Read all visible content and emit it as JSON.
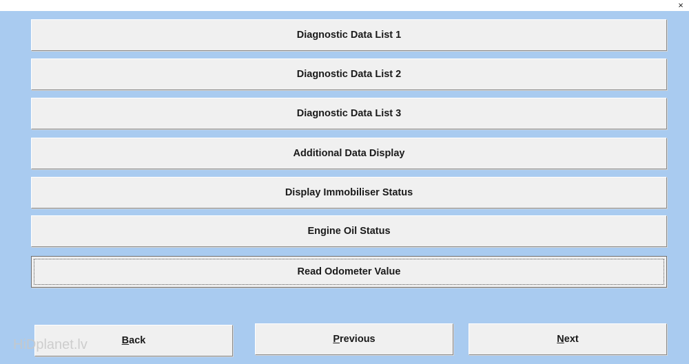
{
  "window": {
    "close_glyph": "×"
  },
  "menu": {
    "items": [
      {
        "label": "Diagnostic Data List 1"
      },
      {
        "label": "Diagnostic Data List 2"
      },
      {
        "label": "Diagnostic Data List 3"
      },
      {
        "label": "Additional Data Display"
      },
      {
        "label": "Display Immobiliser Status"
      },
      {
        "label": "Engine Oil Status"
      },
      {
        "label": "Read Odometer Value"
      }
    ]
  },
  "nav": {
    "back": {
      "mnemonic": "B",
      "rest": "ack"
    },
    "previous": {
      "mnemonic": "P",
      "rest": "revious"
    },
    "next": {
      "mnemonic": "N",
      "rest": "ext"
    }
  },
  "watermark": "HiDplanet.lv",
  "colors": {
    "background": "#a9cbf0",
    "button_face": "#f0f0f0"
  }
}
